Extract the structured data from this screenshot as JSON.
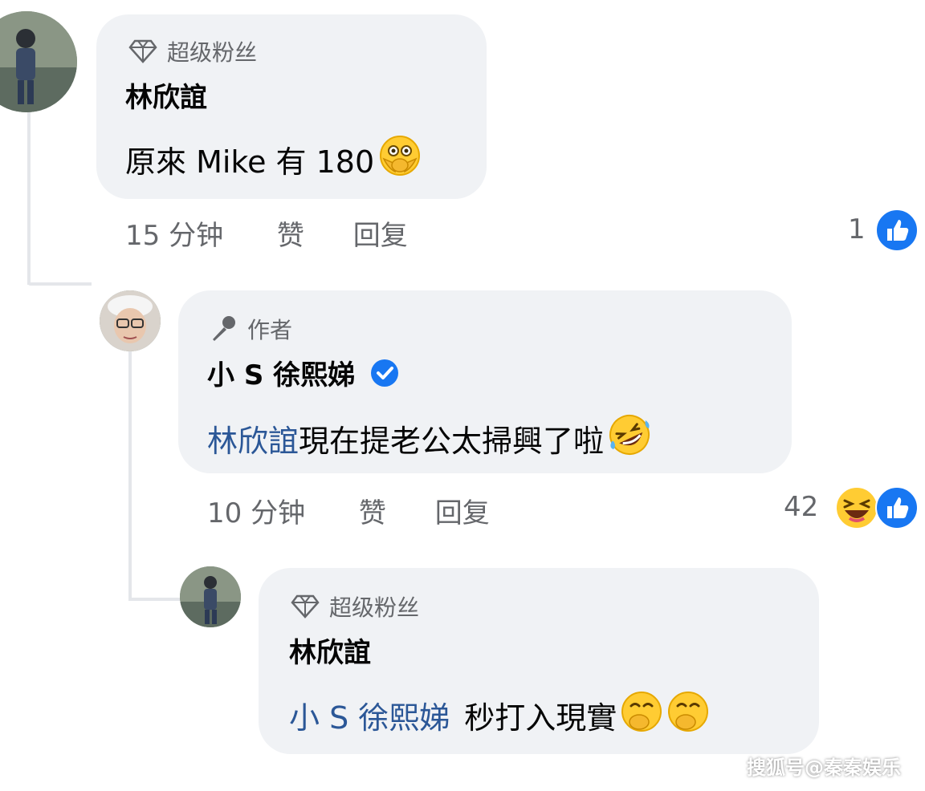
{
  "comments": [
    {
      "badge": "超级粉丝",
      "author": "林欣誼",
      "text": "原來 Mike 有 180",
      "emoji": "face-with-hand-over-mouth-emoji",
      "time": "15 分钟",
      "like": "赞",
      "reply": "回复",
      "reaction_count": "1"
    },
    {
      "badge": "作者",
      "author": "小 S 徐熙娣",
      "verified": true,
      "mention": "林欣誼",
      "text": "現在提老公太掃興了啦",
      "emoji": "rolling-on-floor-laughing-emoji",
      "time": "10 分钟",
      "like": "赞",
      "reply": "回复",
      "reaction_count": "42"
    },
    {
      "badge": "超级粉丝",
      "author": "林欣誼",
      "mention": "小 S 徐熙娣",
      "text": "秒打入現實",
      "emoji": "hand-over-mouth-emoji"
    }
  ],
  "watermark": "搜狐号@秦秦娱乐",
  "colors": {
    "like_blue": "#1877f2",
    "bubble_bg": "#f0f2f5",
    "meta_text": "#65676b",
    "mention": "#2b5797"
  }
}
